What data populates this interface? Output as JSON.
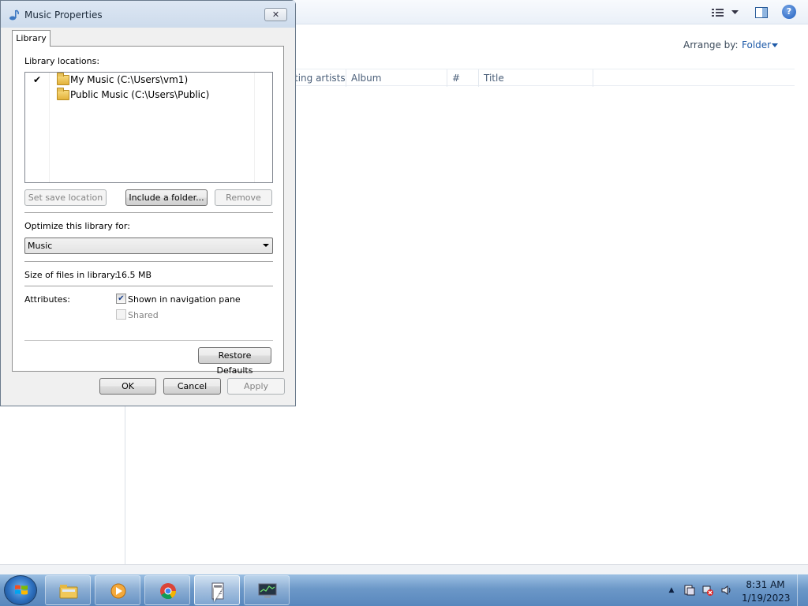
{
  "explorer": {
    "arrange_label": "Arrange by:",
    "arrange_value": "Folder",
    "columns": [
      "ting artists",
      "Album",
      "#",
      "Title"
    ]
  },
  "dialog": {
    "title": "Music Properties",
    "close_glyph": "✕",
    "tab": "Library",
    "library_locations_label": "Library locations:",
    "locations": [
      {
        "checked": "✔",
        "name": "My Music (C:\\Users\\vm1)"
      },
      {
        "checked": "",
        "name": "Public Music (C:\\Users\\Public)"
      }
    ],
    "set_save_location": "Set save location",
    "include_folder": "Include a folder...",
    "remove": "Remove",
    "optimize_label": "Optimize this library for:",
    "optimize_value": "Music",
    "size_label": "Size of files in library:",
    "size_value": "16.5 MB",
    "attributes_label": "Attributes:",
    "shown_in_nav": {
      "label": "Shown in navigation pane",
      "checked": true,
      "glyph": "✔"
    },
    "shared": {
      "label": "Shared",
      "checked": false
    },
    "restore_defaults": "Restore Defaults",
    "ok": "OK",
    "cancel": "Cancel",
    "apply": "Apply"
  },
  "taskbar": {
    "time": "8:31 AM",
    "date": "1/19/2023",
    "items": [
      "start-button",
      "file-explorer",
      "media-player",
      "chrome",
      "notepad-document",
      "system-monitor"
    ]
  },
  "colors": {
    "accent": "#1e5aa8",
    "taskbar": "#6c98c8",
    "dialog_title": "#dde7f3"
  }
}
